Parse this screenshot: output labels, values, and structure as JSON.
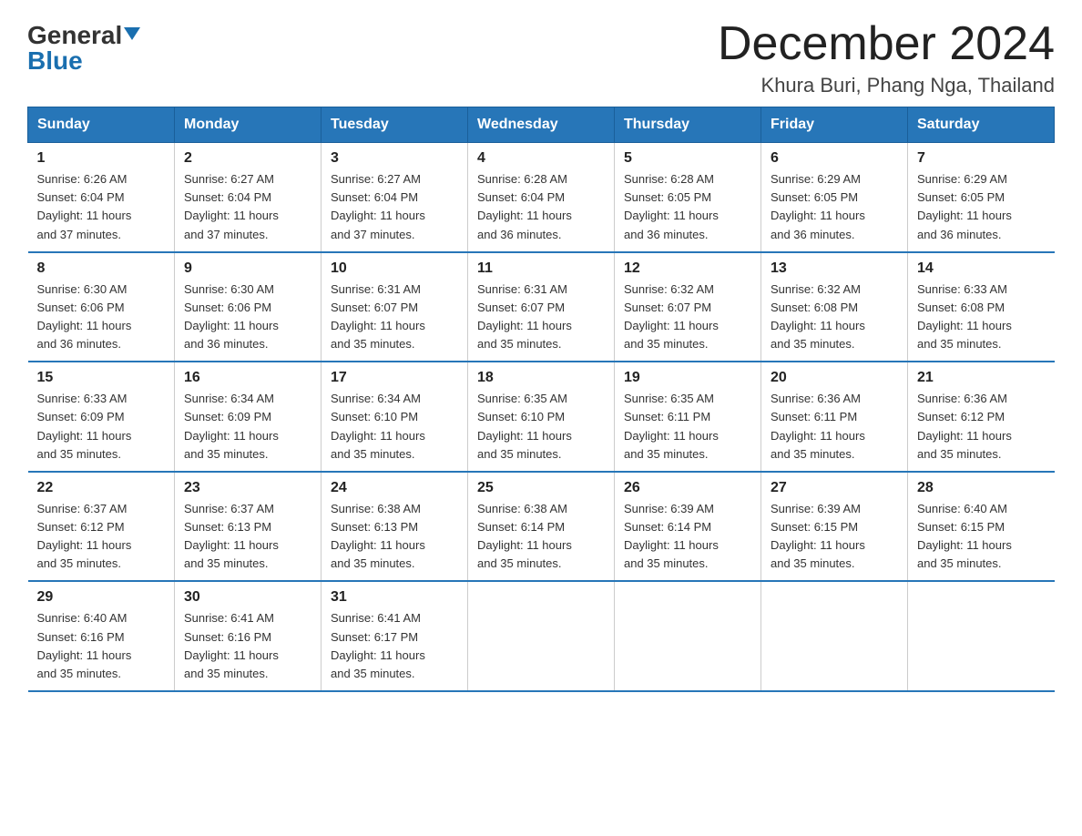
{
  "logo": {
    "general": "General",
    "blue": "Blue"
  },
  "title": "December 2024",
  "subtitle": "Khura Buri, Phang Nga, Thailand",
  "weekdays": [
    "Sunday",
    "Monday",
    "Tuesday",
    "Wednesday",
    "Thursday",
    "Friday",
    "Saturday"
  ],
  "weeks": [
    [
      {
        "day": "1",
        "info": "Sunrise: 6:26 AM\nSunset: 6:04 PM\nDaylight: 11 hours\nand 37 minutes."
      },
      {
        "day": "2",
        "info": "Sunrise: 6:27 AM\nSunset: 6:04 PM\nDaylight: 11 hours\nand 37 minutes."
      },
      {
        "day": "3",
        "info": "Sunrise: 6:27 AM\nSunset: 6:04 PM\nDaylight: 11 hours\nand 37 minutes."
      },
      {
        "day": "4",
        "info": "Sunrise: 6:28 AM\nSunset: 6:04 PM\nDaylight: 11 hours\nand 36 minutes."
      },
      {
        "day": "5",
        "info": "Sunrise: 6:28 AM\nSunset: 6:05 PM\nDaylight: 11 hours\nand 36 minutes."
      },
      {
        "day": "6",
        "info": "Sunrise: 6:29 AM\nSunset: 6:05 PM\nDaylight: 11 hours\nand 36 minutes."
      },
      {
        "day": "7",
        "info": "Sunrise: 6:29 AM\nSunset: 6:05 PM\nDaylight: 11 hours\nand 36 minutes."
      }
    ],
    [
      {
        "day": "8",
        "info": "Sunrise: 6:30 AM\nSunset: 6:06 PM\nDaylight: 11 hours\nand 36 minutes."
      },
      {
        "day": "9",
        "info": "Sunrise: 6:30 AM\nSunset: 6:06 PM\nDaylight: 11 hours\nand 36 minutes."
      },
      {
        "day": "10",
        "info": "Sunrise: 6:31 AM\nSunset: 6:07 PM\nDaylight: 11 hours\nand 35 minutes."
      },
      {
        "day": "11",
        "info": "Sunrise: 6:31 AM\nSunset: 6:07 PM\nDaylight: 11 hours\nand 35 minutes."
      },
      {
        "day": "12",
        "info": "Sunrise: 6:32 AM\nSunset: 6:07 PM\nDaylight: 11 hours\nand 35 minutes."
      },
      {
        "day": "13",
        "info": "Sunrise: 6:32 AM\nSunset: 6:08 PM\nDaylight: 11 hours\nand 35 minutes."
      },
      {
        "day": "14",
        "info": "Sunrise: 6:33 AM\nSunset: 6:08 PM\nDaylight: 11 hours\nand 35 minutes."
      }
    ],
    [
      {
        "day": "15",
        "info": "Sunrise: 6:33 AM\nSunset: 6:09 PM\nDaylight: 11 hours\nand 35 minutes."
      },
      {
        "day": "16",
        "info": "Sunrise: 6:34 AM\nSunset: 6:09 PM\nDaylight: 11 hours\nand 35 minutes."
      },
      {
        "day": "17",
        "info": "Sunrise: 6:34 AM\nSunset: 6:10 PM\nDaylight: 11 hours\nand 35 minutes."
      },
      {
        "day": "18",
        "info": "Sunrise: 6:35 AM\nSunset: 6:10 PM\nDaylight: 11 hours\nand 35 minutes."
      },
      {
        "day": "19",
        "info": "Sunrise: 6:35 AM\nSunset: 6:11 PM\nDaylight: 11 hours\nand 35 minutes."
      },
      {
        "day": "20",
        "info": "Sunrise: 6:36 AM\nSunset: 6:11 PM\nDaylight: 11 hours\nand 35 minutes."
      },
      {
        "day": "21",
        "info": "Sunrise: 6:36 AM\nSunset: 6:12 PM\nDaylight: 11 hours\nand 35 minutes."
      }
    ],
    [
      {
        "day": "22",
        "info": "Sunrise: 6:37 AM\nSunset: 6:12 PM\nDaylight: 11 hours\nand 35 minutes."
      },
      {
        "day": "23",
        "info": "Sunrise: 6:37 AM\nSunset: 6:13 PM\nDaylight: 11 hours\nand 35 minutes."
      },
      {
        "day": "24",
        "info": "Sunrise: 6:38 AM\nSunset: 6:13 PM\nDaylight: 11 hours\nand 35 minutes."
      },
      {
        "day": "25",
        "info": "Sunrise: 6:38 AM\nSunset: 6:14 PM\nDaylight: 11 hours\nand 35 minutes."
      },
      {
        "day": "26",
        "info": "Sunrise: 6:39 AM\nSunset: 6:14 PM\nDaylight: 11 hours\nand 35 minutes."
      },
      {
        "day": "27",
        "info": "Sunrise: 6:39 AM\nSunset: 6:15 PM\nDaylight: 11 hours\nand 35 minutes."
      },
      {
        "day": "28",
        "info": "Sunrise: 6:40 AM\nSunset: 6:15 PM\nDaylight: 11 hours\nand 35 minutes."
      }
    ],
    [
      {
        "day": "29",
        "info": "Sunrise: 6:40 AM\nSunset: 6:16 PM\nDaylight: 11 hours\nand 35 minutes."
      },
      {
        "day": "30",
        "info": "Sunrise: 6:41 AM\nSunset: 6:16 PM\nDaylight: 11 hours\nand 35 minutes."
      },
      {
        "day": "31",
        "info": "Sunrise: 6:41 AM\nSunset: 6:17 PM\nDaylight: 11 hours\nand 35 minutes."
      },
      null,
      null,
      null,
      null
    ]
  ]
}
